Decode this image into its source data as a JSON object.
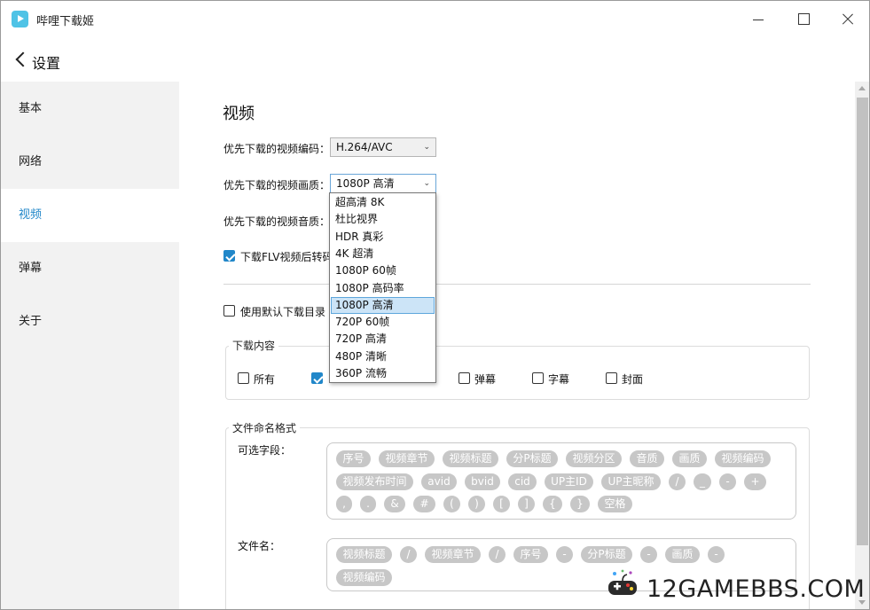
{
  "app": {
    "title": "哔哩下载姬"
  },
  "header": {
    "title": "设置"
  },
  "sidebar": {
    "items": [
      {
        "label": "基本"
      },
      {
        "label": "网络"
      },
      {
        "label": "视频",
        "active": true
      },
      {
        "label": "弹幕"
      },
      {
        "label": "关于"
      }
    ]
  },
  "video": {
    "section_title": "视频",
    "codec_label": "优先下载的视频编码：",
    "codec_value": "H.264/AVC",
    "quality_label": "优先下载的视频画质：",
    "quality_value": "1080P 高清",
    "audio_label": "优先下载的视频音质：",
    "flv_label": "下载FLV视频后转码",
    "flv_checked": true,
    "default_dir_label": "使用默认下载目录",
    "default_dir_checked": false
  },
  "quality_dropdown": {
    "options": [
      "超高清 8K",
      "杜比视界",
      "HDR 真彩",
      "4K 超清",
      "1080P 60帧",
      "1080P 高码率",
      "1080P 高清",
      "720P 60帧",
      "720P 高清",
      "480P 清晰",
      "360P 流畅"
    ],
    "selected_index": 6
  },
  "download_content": {
    "legend": "下载内容",
    "items": [
      {
        "label": "所有",
        "checked": false
      },
      {
        "label": "",
        "checked": true
      },
      {
        "label": "弹幕",
        "checked": false
      },
      {
        "label": "字幕",
        "checked": false
      },
      {
        "label": "封面",
        "checked": false
      }
    ]
  },
  "naming": {
    "legend": "文件命名格式",
    "optional_label": "可选字段：",
    "optional_chips": [
      "序号",
      "视频章节",
      "视频标题",
      "分P标题",
      "视频分区",
      "音质",
      "画质",
      "视频编码",
      "视频发布时间",
      "avid",
      "bvid",
      "cid",
      "UP主ID",
      "UP主昵称",
      "/",
      "_",
      "-",
      "+",
      ",",
      ".",
      "&",
      "#",
      "(",
      ")",
      "[",
      "]",
      "{",
      "}",
      "空格"
    ],
    "filename_label": "文件名：",
    "filename_chips": [
      "视频标题",
      "/",
      "视频章节",
      "/",
      "序号",
      "-",
      "分P标题",
      "-",
      "画质",
      "-",
      "视频编码"
    ]
  },
  "watermark": {
    "text": "12GAMEBBS.COM"
  },
  "colors": {
    "accent": "#2187c9",
    "chip": "#c7c7c7",
    "sidebar_bg": "#f2f2f2"
  }
}
